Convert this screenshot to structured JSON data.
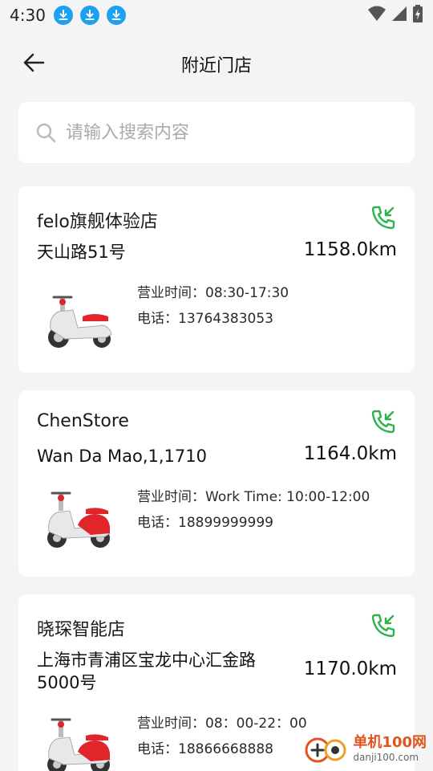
{
  "status_bar": {
    "time": "4:30",
    "notification_icons": [
      "download-icon",
      "download-icon",
      "download-icon"
    ],
    "right_icons": [
      "wifi-icon",
      "signal-icon",
      "battery-icon"
    ]
  },
  "header": {
    "back_icon": "arrow-left-icon",
    "title": "附近门店"
  },
  "search": {
    "placeholder": "请输入搜索内容",
    "value": ""
  },
  "stores": [
    {
      "name": "felo旗舰体验店",
      "address": "天山路51号",
      "distance": "1158.0km",
      "hours": "营业时间：08:30-17:30",
      "phone": "电话：13764383053"
    },
    {
      "name": "ChenStore",
      "address": "Wan Da Mao,1,1710",
      "distance": "1164.0km",
      "hours": "营业时间：Work Time: 10:00-12:00",
      "phone": "电话：18899999999"
    },
    {
      "name": "晓琛智能店",
      "address": "上海市青浦区宝龙中心汇金路5000号",
      "distance": "1170.0km",
      "hours": "营业时间：08：00-22：00",
      "phone": "电话：18866668888"
    }
  ],
  "watermark": {
    "cn": "单机100网",
    "en": "danji100.com"
  },
  "colors": {
    "accent_green": "#2db34a",
    "notification_blue": "#1ea0f0",
    "scooter_red": "#e0252b"
  }
}
